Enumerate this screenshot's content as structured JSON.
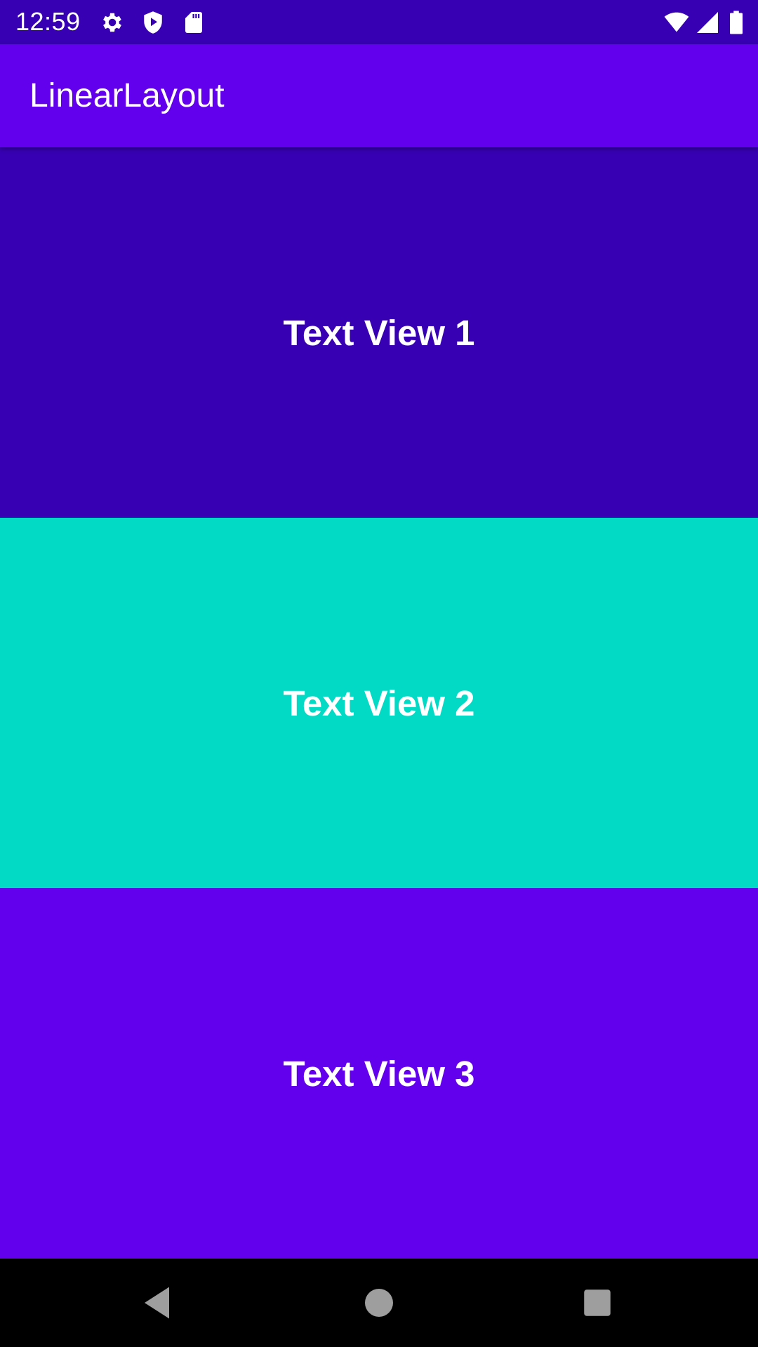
{
  "status_bar": {
    "time": "12:59",
    "icons": [
      "gear-icon",
      "shield-play-icon",
      "sd-card-icon",
      "wifi-icon",
      "cell-signal-icon",
      "battery-icon"
    ]
  },
  "app_bar": {
    "title": "LinearLayout"
  },
  "panels": [
    {
      "label": "Text View 1",
      "background": "#3700B3"
    },
    {
      "label": "Text View 2",
      "background": "#03DAC5"
    },
    {
      "label": "Text View 3",
      "background": "#6200EE"
    }
  ],
  "nav_bar": {
    "buttons": [
      "back-icon",
      "home-icon",
      "recents-icon"
    ]
  },
  "colors": {
    "status_bar": "#3700B3",
    "app_bar": "#6200EE",
    "text": "#FFFFFF",
    "nav_bar": "#000000",
    "nav_icon": "#9E9E9E"
  }
}
